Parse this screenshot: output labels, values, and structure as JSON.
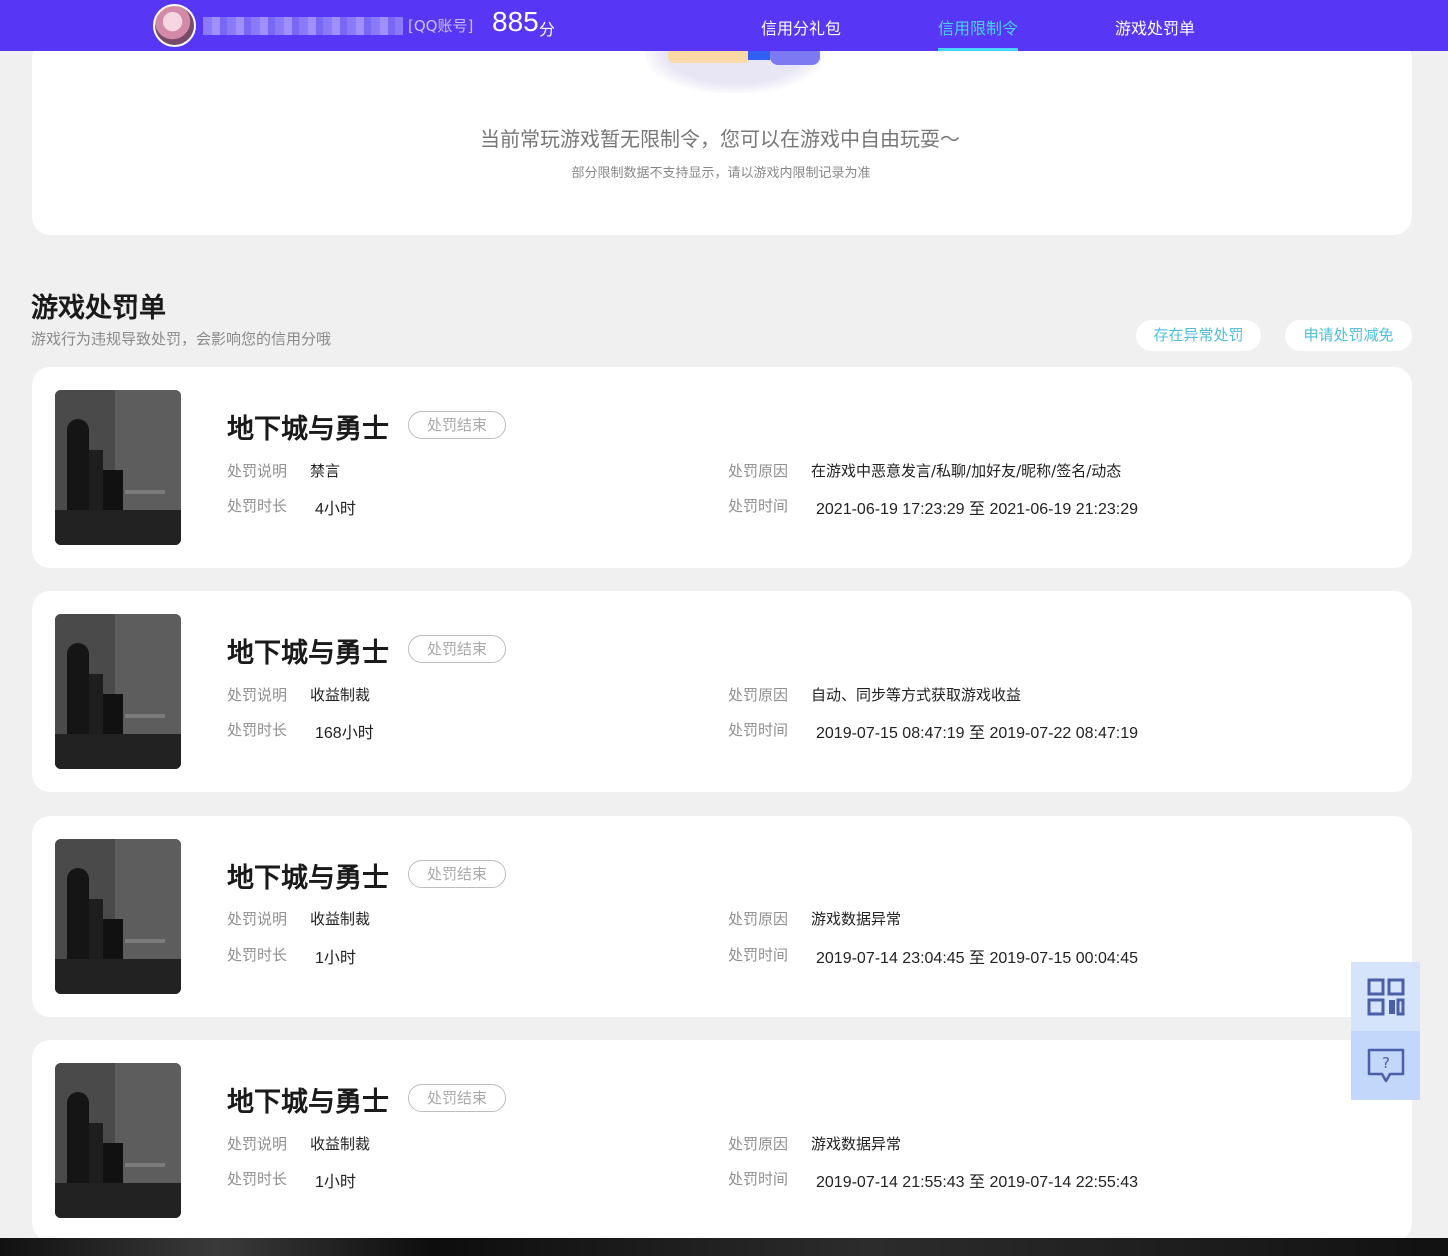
{
  "header": {
    "account_tag": "[QQ账号]",
    "score": "885",
    "score_unit": "分",
    "nav": [
      {
        "label": "信用分礼包",
        "active": false
      },
      {
        "label": "信用限制令",
        "active": true
      },
      {
        "label": "游戏处罚单",
        "active": false
      }
    ]
  },
  "restriction": {
    "empty_title": "当前常玩游戏暂无限制令，您可以在游戏中自由玩耍～",
    "empty_subtitle": "部分限制数据不支持显示，请以游戏内限制记录为准"
  },
  "penalty": {
    "title": "游戏处罚单",
    "subtitle": "游戏行为违规导致处罚，会影响您的信用分哦",
    "actions": [
      "存在异常处罚",
      "申请处罚减免"
    ],
    "labels": {
      "desc": "处罚说明",
      "duration": "处罚时长",
      "reason": "处罚原因",
      "time": "处罚时间"
    },
    "items": [
      {
        "game": "地下城与勇士",
        "status": "处罚结束",
        "desc": "禁言",
        "duration": "4小时",
        "reason": "在游戏中恶意发言/私聊/加好友/昵称/签名/动态",
        "time": "2021-06-19 17:23:29 至 2021-06-19 21:23:29"
      },
      {
        "game": "地下城与勇士",
        "status": "处罚结束",
        "desc": "收益制裁",
        "duration": "168小时",
        "reason": "自动、同步等方式获取游戏收益",
        "time": "2019-07-15 08:47:19 至 2019-07-22 08:47:19"
      },
      {
        "game": "地下城与勇士",
        "status": "处罚结束",
        "desc": "收益制裁",
        "duration": "1小时",
        "reason": "游戏数据异常",
        "time": "2019-07-14 23:04:45 至 2019-07-15 00:04:45"
      },
      {
        "game": "地下城与勇士",
        "status": "处罚结束",
        "desc": "收益制裁",
        "duration": "1小时",
        "reason": "游戏数据异常",
        "time": "2019-07-14 21:55:43 至 2019-07-14 22:55:43"
      }
    ]
  },
  "float_buttons": [
    "qrcode-icon",
    "help-icon"
  ],
  "colors": {
    "header_bg": "#5736f5",
    "nav_active": "#47d5ff",
    "pill_text": "#4ec0d8",
    "page_bg": "#f0f0f0"
  }
}
